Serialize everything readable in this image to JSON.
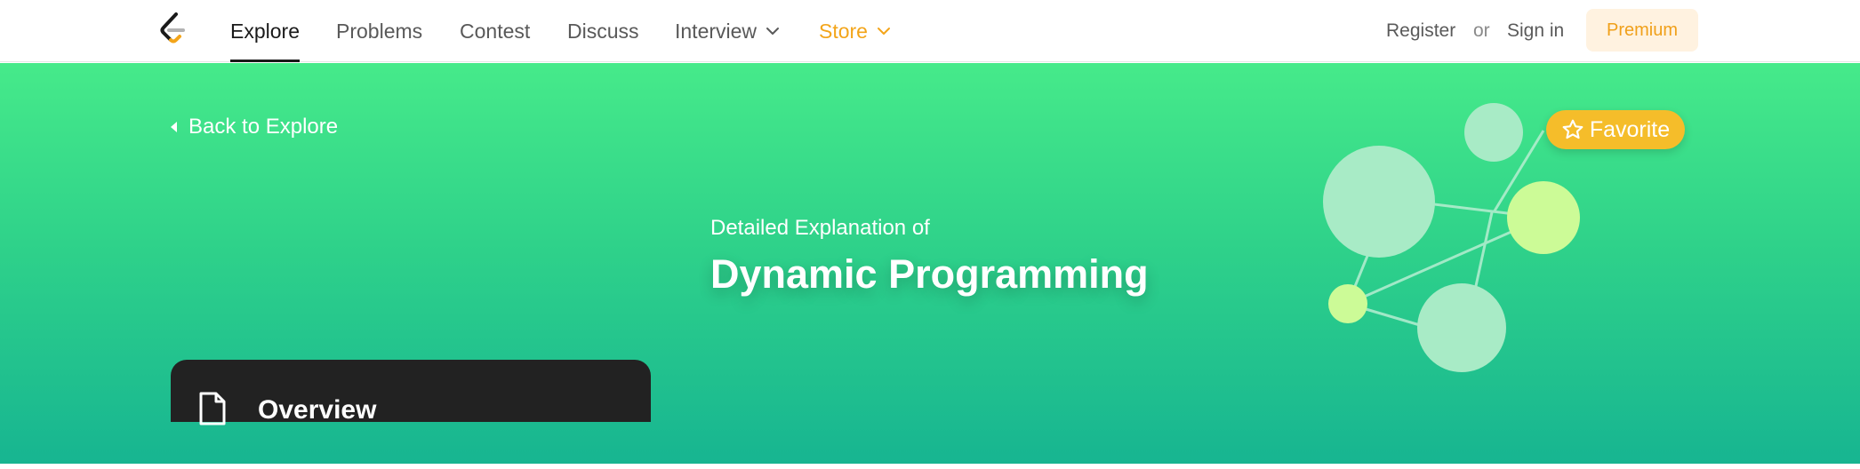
{
  "nav": {
    "items": [
      {
        "label": "Explore",
        "active": true
      },
      {
        "label": "Problems"
      },
      {
        "label": "Contest"
      },
      {
        "label": "Discuss"
      },
      {
        "label": "Interview",
        "has_dropdown": true
      },
      {
        "label": "Store",
        "has_dropdown": true
      }
    ],
    "register": "Register",
    "or": "or",
    "sign_in": "Sign in",
    "premium": "Premium"
  },
  "hero": {
    "back_label": "Back to Explore",
    "subtitle": "Detailed Explanation of",
    "title": "Dynamic Programming",
    "favorite_label": "Favorite"
  },
  "overview": {
    "label": "Overview"
  },
  "colors": {
    "accent_orange": "#f3a51a",
    "premium_bg": "#fff2e0",
    "hero_top": "#46ea8a",
    "hero_bottom": "#17b591",
    "favorite_bg": "#f5bd2a",
    "card_bg": "#222222"
  },
  "icons": [
    "leetcode-logo",
    "chevron-down-icon",
    "caret-left-icon",
    "star-icon",
    "document-icon"
  ]
}
